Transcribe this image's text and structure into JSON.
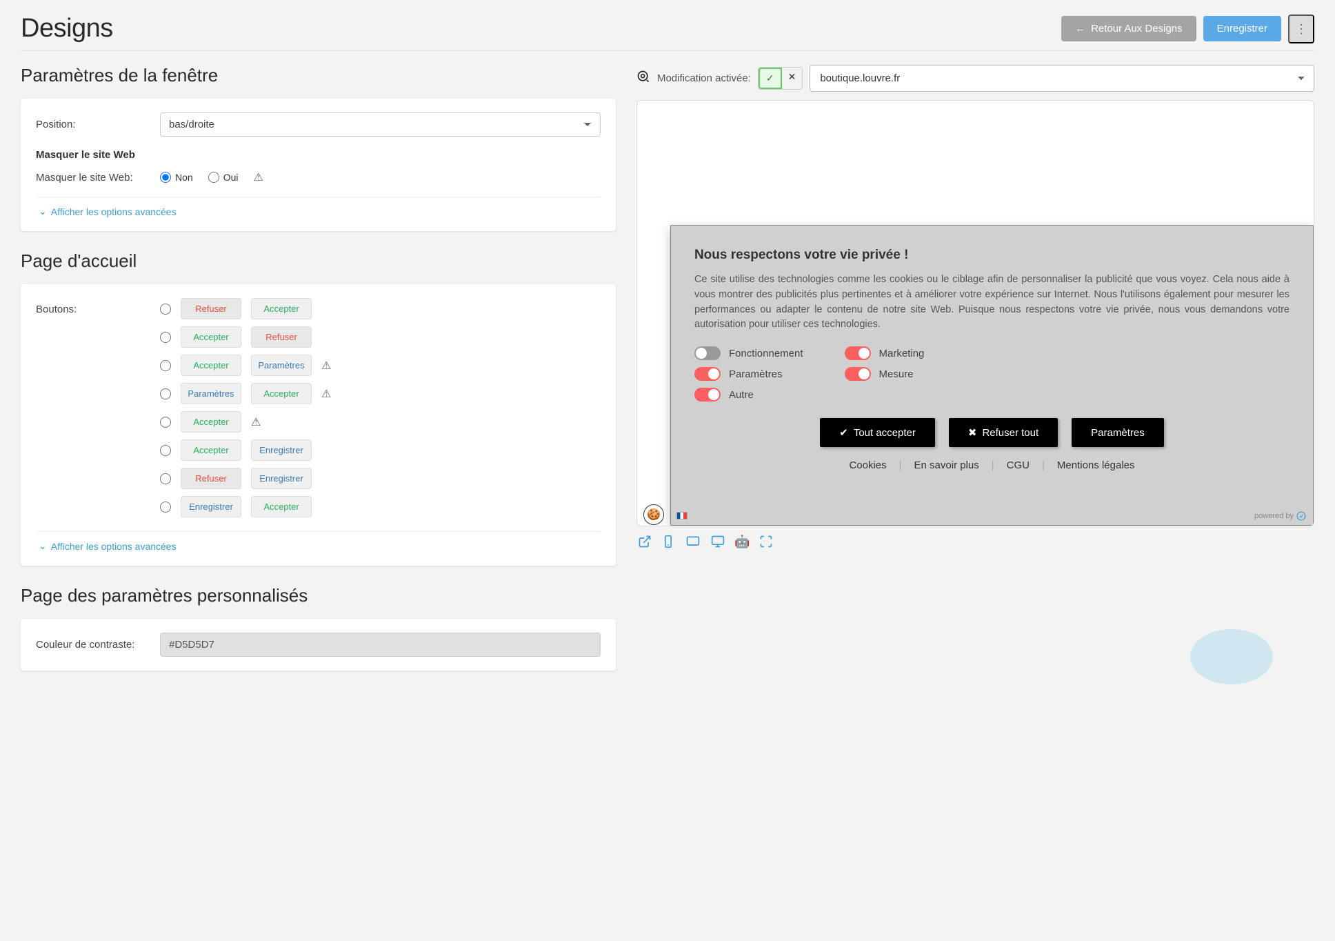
{
  "header": {
    "title": "Designs",
    "back_button": "Retour Aux Designs",
    "save_button": "Enregistrer"
  },
  "window_settings": {
    "title": "Paramètres de la fenêtre",
    "position_label": "Position:",
    "position_value": "bas/droite",
    "hide_site_heading": "Masquer le site Web",
    "hide_site_label": "Masquer le site Web:",
    "option_no": "Non",
    "option_yes": "Oui",
    "advanced_link": "Afficher les options avancées"
  },
  "home_page": {
    "title": "Page d'accueil",
    "buttons_label": "Boutons:",
    "rows": [
      {
        "left": "Refuser",
        "left_color": "red",
        "right": "Accepter",
        "right_color": "green",
        "warn": false
      },
      {
        "left": "Accepter",
        "left_color": "green",
        "right": "Refuser",
        "right_color": "red",
        "warn": false
      },
      {
        "left": "Accepter",
        "left_color": "green",
        "right": "Paramètres",
        "right_color": "blue",
        "warn": true
      },
      {
        "left": "Paramètres",
        "left_color": "blue",
        "right": "Accepter",
        "right_color": "green",
        "warn": true
      },
      {
        "left": "Accepter",
        "left_color": "green",
        "right": "",
        "right_color": "",
        "warn": true
      },
      {
        "left": "Accepter",
        "left_color": "green",
        "right": "Enregistrer",
        "right_color": "blue",
        "warn": false
      },
      {
        "left": "Refuser",
        "left_color": "red",
        "right": "Enregistrer",
        "right_color": "blue",
        "warn": false
      },
      {
        "left": "Enregistrer",
        "left_color": "blue",
        "right": "Accepter",
        "right_color": "green",
        "warn": false
      }
    ],
    "advanced_link": "Afficher les options avancées"
  },
  "custom_params": {
    "title": "Page des paramètres personnalisés",
    "contrast_label": "Couleur de contraste:",
    "contrast_value": "#D5D5D7"
  },
  "preview": {
    "edit_label": "Modification activée:",
    "domain": "boutique.louvre.fr"
  },
  "cookie_popup": {
    "title": "Nous respectons votre vie privée !",
    "text": "Ce site utilise des technologies comme les cookies ou le ciblage afin de personnaliser la publicité que vous voyez. Cela nous aide à vous montrer des publicités plus pertinentes et à améliorer votre expérience sur Internet. Nous l'utilisons également pour mesurer les performances ou adapter le contenu de notre site Web. Puisque nous respectons votre vie privée, nous vous demandons votre autorisation pour utiliser ces technologies.",
    "toggles": {
      "fonctionnement": "Fonctionnement",
      "parametres": "Paramètres",
      "autre": "Autre",
      "marketing": "Marketing",
      "mesure": "Mesure"
    },
    "accept_all": "Tout accepter",
    "refuse_all": "Refuser tout",
    "params": "Paramètres",
    "links": {
      "cookies": "Cookies",
      "learn_more": "En savoir plus",
      "cgu": "CGU",
      "legal": "Mentions légales"
    },
    "powered": "powered by"
  }
}
